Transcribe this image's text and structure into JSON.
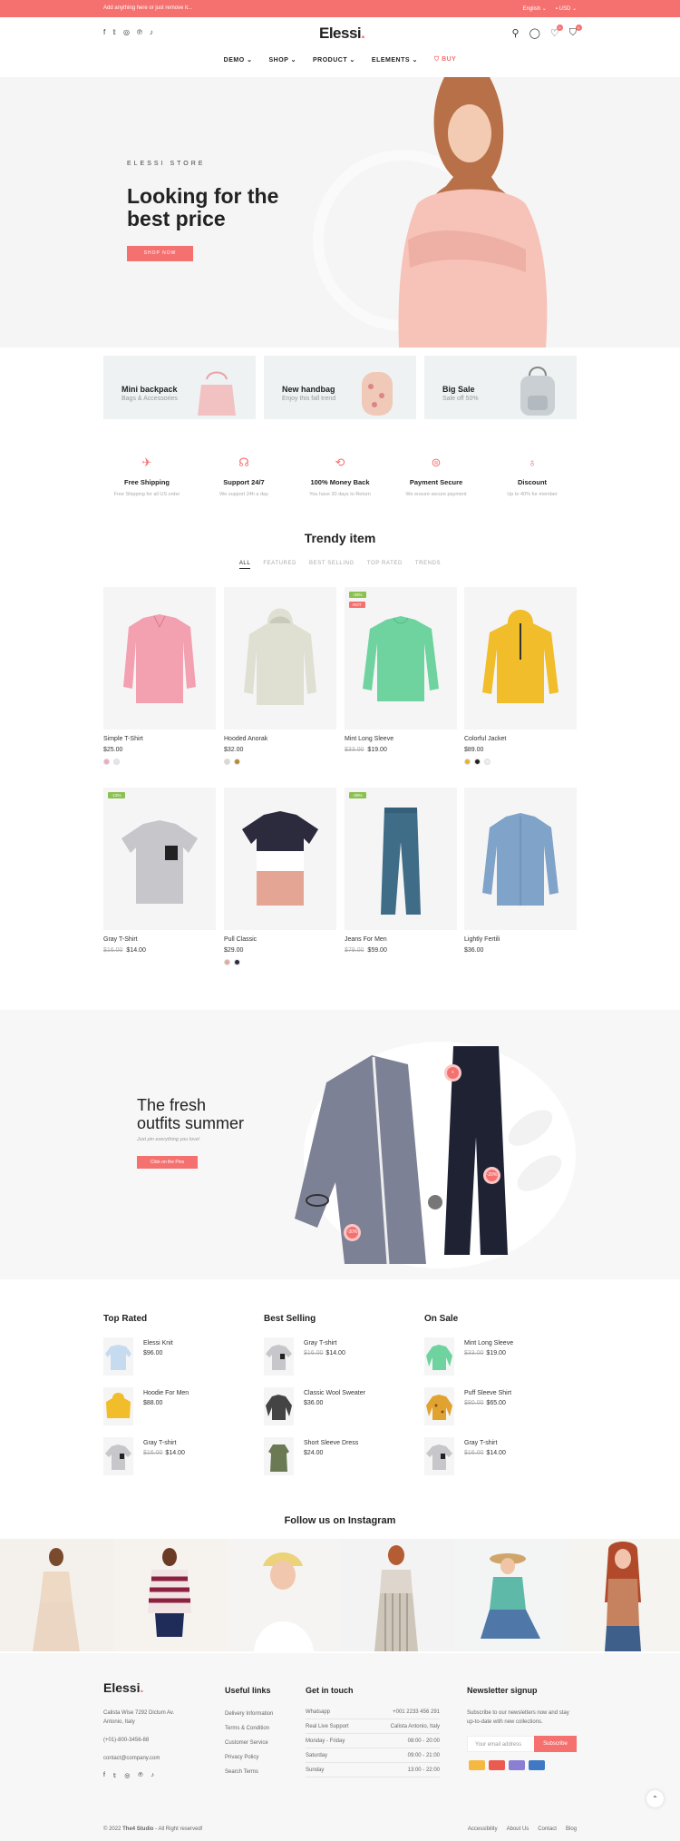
{
  "topbar": {
    "message": "Add anything here or just remove it...",
    "language": "English ⌄",
    "currency": "USD ⌄"
  },
  "header": {
    "logo": "Elessi",
    "logo_dot": ".",
    "cart_count": "0",
    "wishlist_count": "0"
  },
  "nav": {
    "items": [
      {
        "label": "DEMO ⌄"
      },
      {
        "label": "SHOP ⌄"
      },
      {
        "label": "PRODUCT ⌄"
      },
      {
        "label": "ELEMENTS ⌄"
      }
    ],
    "buy": "BUY"
  },
  "hero": {
    "kicker": "ELESSI STORE",
    "title": "Looking for the best price",
    "button": "SHOP NOW"
  },
  "banners": [
    {
      "title": "Mini backpack",
      "subtitle": "Bags & Accessories"
    },
    {
      "title": "New handbag",
      "subtitle": "Enjoy this fall trend"
    },
    {
      "title": "Big Sale",
      "subtitle": "Sale off 50%"
    }
  ],
  "features": [
    {
      "title": "Free Shipping",
      "subtitle": "Free Shipping for all US order"
    },
    {
      "title": "Support 24/7",
      "subtitle": "We support 24h a day"
    },
    {
      "title": "100% Money Back",
      "subtitle": "You have 30 days to Return"
    },
    {
      "title": "Payment Secure",
      "subtitle": "We ensure secure payment"
    },
    {
      "title": "Discount",
      "subtitle": "Up to 40% for member"
    }
  ],
  "trendy": {
    "title": "Trendy item",
    "tabs": [
      "ALL",
      "FEATURED",
      "BEST SELLING",
      "TOP RATED",
      "TRENDS"
    ],
    "products": [
      {
        "name": "Simple T-Shirt",
        "price": "$25.00",
        "old": "",
        "swatches": [
          "#f2a7b8",
          "#e4e4f0"
        ]
      },
      {
        "name": "Hooded Anorak",
        "price": "$32.00",
        "old": "",
        "swatches": [
          "#d9d9cf",
          "#b88a2a"
        ]
      },
      {
        "name": "Mint Long Sleeve",
        "price": "$19.00",
        "old": "$33.00",
        "tags": [
          "-33%",
          "HOT"
        ]
      },
      {
        "name": "Colorful Jacket",
        "price": "$89.00",
        "old": "",
        "swatches": [
          "#e8b423",
          "#222222",
          "#eeeeee"
        ]
      },
      {
        "name": "Gray T-Shirt",
        "price": "$14.00",
        "old": "$16.00",
        "tags": [
          "-13%"
        ]
      },
      {
        "name": "Pull Classic",
        "price": "$29.00",
        "old": "",
        "swatches": [
          "#e6a89a",
          "#2b2b3d"
        ]
      },
      {
        "name": "Jeans For Men",
        "price": "$59.00",
        "old": "$79.00",
        "tags": [
          "-25%"
        ]
      },
      {
        "name": "Lightly Fertili",
        "price": "$36.00",
        "old": ""
      }
    ]
  },
  "summer": {
    "title_line1": "The fresh",
    "title_line2": "outfits summer",
    "subtitle": "Just pin everything you love!",
    "button": "Click on the Pins",
    "pins": [
      "+",
      "-20%",
      "-30%"
    ]
  },
  "lists": [
    {
      "heading": "Top Rated",
      "items": [
        {
          "name": "Elessi Knit",
          "price": "$96.00",
          "old": ""
        },
        {
          "name": "Hoodie For Men",
          "price": "$88.00",
          "old": ""
        },
        {
          "name": "Gray T-shirt",
          "price": "$14.00",
          "old": "$16.00"
        }
      ]
    },
    {
      "heading": "Best Selling",
      "items": [
        {
          "name": "Gray T-shirt",
          "price": "$14.00",
          "old": "$16.00"
        },
        {
          "name": "Classic Wool Sweater",
          "price": "$36.00",
          "old": ""
        },
        {
          "name": "Short Sleeve Dress",
          "price": "$24.00",
          "old": ""
        }
      ]
    },
    {
      "heading": "On Sale",
      "items": [
        {
          "name": "Mint Long Sleeve",
          "price": "$19.00",
          "old": "$33.00"
        },
        {
          "name": "Puff Sleeve Shirt",
          "price": "$65.00",
          "old": "$80.00"
        },
        {
          "name": "Gray T-shirt",
          "price": "$14.00",
          "old": "$16.00"
        }
      ]
    }
  ],
  "instagram": {
    "title": "Follow us on Instagram"
  },
  "footer": {
    "logo": "Elessi",
    "address": "Calista Wise 7292 Dictum Av. Antonio, Italy",
    "phone": "(+01)-800-3456-88",
    "email": "contact@company.com",
    "useful_title": "Useful links",
    "useful": [
      "Delivery Information",
      "Terms & Condition",
      "Customer Service",
      "Privacy Policy",
      "Search Terms"
    ],
    "touch_title": "Get in touch",
    "touch": [
      {
        "k": "Whatsapp",
        "v": "+001 2233 456 291"
      },
      {
        "k": "Real Live Support",
        "v": "Calista Antonio, Italy"
      },
      {
        "k": "Monday - Friday",
        "v": "08:00 - 20:00"
      },
      {
        "k": "Saturday",
        "v": "09:00 - 21:00"
      },
      {
        "k": "Sunday",
        "v": "13:00 - 22:00"
      }
    ],
    "newsletter_title": "Newsletter signup",
    "newsletter_text": "Subscribe to our newsletters now and stay up-to-date with new collections.",
    "email_placeholder": "Your email address",
    "subscribe": "Subscribe",
    "copyright_pre": "© 2022 ",
    "copyright_brand": "The4 Studio",
    "copyright_post": " - All Right reserved!",
    "bottom_links": [
      "Accessibility",
      "About Us",
      "Contact",
      "Blog"
    ]
  },
  "colors": {
    "accent": "#f47170",
    "sale_tag": "#8cc152",
    "hot_tag": "#f47170"
  }
}
